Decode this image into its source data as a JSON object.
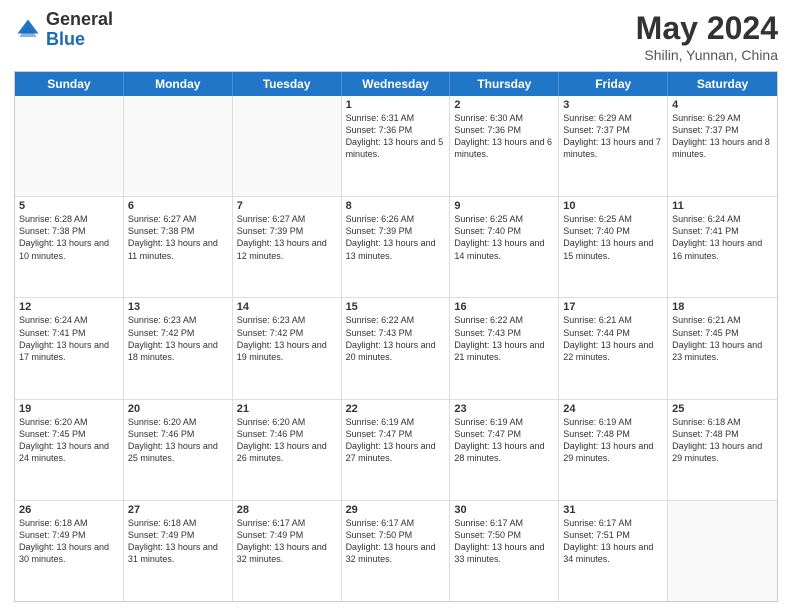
{
  "header": {
    "logo_general": "General",
    "logo_blue": "Blue",
    "title": "May 2024",
    "location": "Shilin, Yunnan, China"
  },
  "days_of_week": [
    "Sunday",
    "Monday",
    "Tuesday",
    "Wednesday",
    "Thursday",
    "Friday",
    "Saturday"
  ],
  "weeks": [
    [
      {
        "day": "",
        "sunrise": "",
        "sunset": "",
        "daylight": ""
      },
      {
        "day": "",
        "sunrise": "",
        "sunset": "",
        "daylight": ""
      },
      {
        "day": "",
        "sunrise": "",
        "sunset": "",
        "daylight": ""
      },
      {
        "day": "1",
        "sunrise": "Sunrise: 6:31 AM",
        "sunset": "Sunset: 7:36 PM",
        "daylight": "Daylight: 13 hours and 5 minutes."
      },
      {
        "day": "2",
        "sunrise": "Sunrise: 6:30 AM",
        "sunset": "Sunset: 7:36 PM",
        "daylight": "Daylight: 13 hours and 6 minutes."
      },
      {
        "day": "3",
        "sunrise": "Sunrise: 6:29 AM",
        "sunset": "Sunset: 7:37 PM",
        "daylight": "Daylight: 13 hours and 7 minutes."
      },
      {
        "day": "4",
        "sunrise": "Sunrise: 6:29 AM",
        "sunset": "Sunset: 7:37 PM",
        "daylight": "Daylight: 13 hours and 8 minutes."
      }
    ],
    [
      {
        "day": "5",
        "sunrise": "Sunrise: 6:28 AM",
        "sunset": "Sunset: 7:38 PM",
        "daylight": "Daylight: 13 hours and 10 minutes."
      },
      {
        "day": "6",
        "sunrise": "Sunrise: 6:27 AM",
        "sunset": "Sunset: 7:38 PM",
        "daylight": "Daylight: 13 hours and 11 minutes."
      },
      {
        "day": "7",
        "sunrise": "Sunrise: 6:27 AM",
        "sunset": "Sunset: 7:39 PM",
        "daylight": "Daylight: 13 hours and 12 minutes."
      },
      {
        "day": "8",
        "sunrise": "Sunrise: 6:26 AM",
        "sunset": "Sunset: 7:39 PM",
        "daylight": "Daylight: 13 hours and 13 minutes."
      },
      {
        "day": "9",
        "sunrise": "Sunrise: 6:25 AM",
        "sunset": "Sunset: 7:40 PM",
        "daylight": "Daylight: 13 hours and 14 minutes."
      },
      {
        "day": "10",
        "sunrise": "Sunrise: 6:25 AM",
        "sunset": "Sunset: 7:40 PM",
        "daylight": "Daylight: 13 hours and 15 minutes."
      },
      {
        "day": "11",
        "sunrise": "Sunrise: 6:24 AM",
        "sunset": "Sunset: 7:41 PM",
        "daylight": "Daylight: 13 hours and 16 minutes."
      }
    ],
    [
      {
        "day": "12",
        "sunrise": "Sunrise: 6:24 AM",
        "sunset": "Sunset: 7:41 PM",
        "daylight": "Daylight: 13 hours and 17 minutes."
      },
      {
        "day": "13",
        "sunrise": "Sunrise: 6:23 AM",
        "sunset": "Sunset: 7:42 PM",
        "daylight": "Daylight: 13 hours and 18 minutes."
      },
      {
        "day": "14",
        "sunrise": "Sunrise: 6:23 AM",
        "sunset": "Sunset: 7:42 PM",
        "daylight": "Daylight: 13 hours and 19 minutes."
      },
      {
        "day": "15",
        "sunrise": "Sunrise: 6:22 AM",
        "sunset": "Sunset: 7:43 PM",
        "daylight": "Daylight: 13 hours and 20 minutes."
      },
      {
        "day": "16",
        "sunrise": "Sunrise: 6:22 AM",
        "sunset": "Sunset: 7:43 PM",
        "daylight": "Daylight: 13 hours and 21 minutes."
      },
      {
        "day": "17",
        "sunrise": "Sunrise: 6:21 AM",
        "sunset": "Sunset: 7:44 PM",
        "daylight": "Daylight: 13 hours and 22 minutes."
      },
      {
        "day": "18",
        "sunrise": "Sunrise: 6:21 AM",
        "sunset": "Sunset: 7:45 PM",
        "daylight": "Daylight: 13 hours and 23 minutes."
      }
    ],
    [
      {
        "day": "19",
        "sunrise": "Sunrise: 6:20 AM",
        "sunset": "Sunset: 7:45 PM",
        "daylight": "Daylight: 13 hours and 24 minutes."
      },
      {
        "day": "20",
        "sunrise": "Sunrise: 6:20 AM",
        "sunset": "Sunset: 7:46 PM",
        "daylight": "Daylight: 13 hours and 25 minutes."
      },
      {
        "day": "21",
        "sunrise": "Sunrise: 6:20 AM",
        "sunset": "Sunset: 7:46 PM",
        "daylight": "Daylight: 13 hours and 26 minutes."
      },
      {
        "day": "22",
        "sunrise": "Sunrise: 6:19 AM",
        "sunset": "Sunset: 7:47 PM",
        "daylight": "Daylight: 13 hours and 27 minutes."
      },
      {
        "day": "23",
        "sunrise": "Sunrise: 6:19 AM",
        "sunset": "Sunset: 7:47 PM",
        "daylight": "Daylight: 13 hours and 28 minutes."
      },
      {
        "day": "24",
        "sunrise": "Sunrise: 6:19 AM",
        "sunset": "Sunset: 7:48 PM",
        "daylight": "Daylight: 13 hours and 29 minutes."
      },
      {
        "day": "25",
        "sunrise": "Sunrise: 6:18 AM",
        "sunset": "Sunset: 7:48 PM",
        "daylight": "Daylight: 13 hours and 29 minutes."
      }
    ],
    [
      {
        "day": "26",
        "sunrise": "Sunrise: 6:18 AM",
        "sunset": "Sunset: 7:49 PM",
        "daylight": "Daylight: 13 hours and 30 minutes."
      },
      {
        "day": "27",
        "sunrise": "Sunrise: 6:18 AM",
        "sunset": "Sunset: 7:49 PM",
        "daylight": "Daylight: 13 hours and 31 minutes."
      },
      {
        "day": "28",
        "sunrise": "Sunrise: 6:17 AM",
        "sunset": "Sunset: 7:49 PM",
        "daylight": "Daylight: 13 hours and 32 minutes."
      },
      {
        "day": "29",
        "sunrise": "Sunrise: 6:17 AM",
        "sunset": "Sunset: 7:50 PM",
        "daylight": "Daylight: 13 hours and 32 minutes."
      },
      {
        "day": "30",
        "sunrise": "Sunrise: 6:17 AM",
        "sunset": "Sunset: 7:50 PM",
        "daylight": "Daylight: 13 hours and 33 minutes."
      },
      {
        "day": "31",
        "sunrise": "Sunrise: 6:17 AM",
        "sunset": "Sunset: 7:51 PM",
        "daylight": "Daylight: 13 hours and 34 minutes."
      },
      {
        "day": "",
        "sunrise": "",
        "sunset": "",
        "daylight": ""
      }
    ]
  ]
}
